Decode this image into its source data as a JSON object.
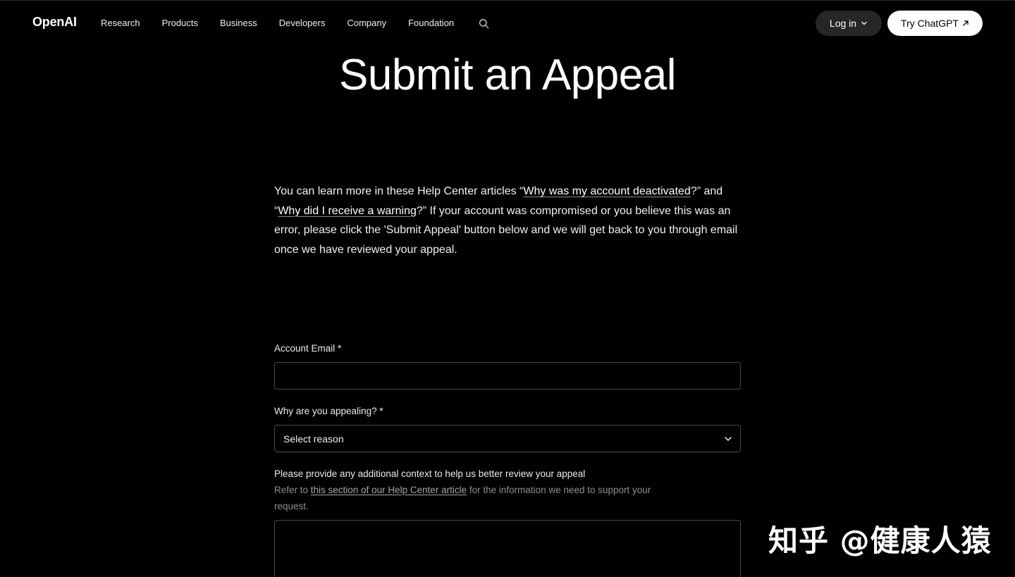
{
  "header": {
    "logo": "OpenAI",
    "nav": [
      "Research",
      "Products",
      "Business",
      "Developers",
      "Company",
      "Foundation"
    ],
    "search_icon": "search-icon",
    "login_label": "Log in",
    "try_label": "Try ChatGPT"
  },
  "main": {
    "title": "Submit an Appeal",
    "intro": {
      "part1": "You can learn more in these Help Center articles “",
      "link1": "Why was my account deactivated",
      "part2": "?” and “",
      "link2": "Why did I receive a warning",
      "part3": "?” If your account was compromised or you believe this was an error, please click the 'Submit Appeal' button below and we will get back to you through email once we have reviewed your appeal."
    }
  },
  "form": {
    "email_label": "Account Email *",
    "email_value": "",
    "reason_label": "Why are you appealing? *",
    "reason_selected": "Select reason",
    "context_label": "Please provide any additional context to help us better review your appeal",
    "help_prefix": "Refer to ",
    "help_link": "this section of our Help Center article",
    "help_suffix": " for the information we need to support your request.",
    "context_value": ""
  },
  "watermark": "知乎 @健康人猿",
  "colors": {
    "background": "#000000",
    "text": "#ffffff",
    "muted": "#8f8f8f",
    "border": "#4a4a4a",
    "login_bg": "#262626",
    "try_bg": "#ffffff"
  }
}
